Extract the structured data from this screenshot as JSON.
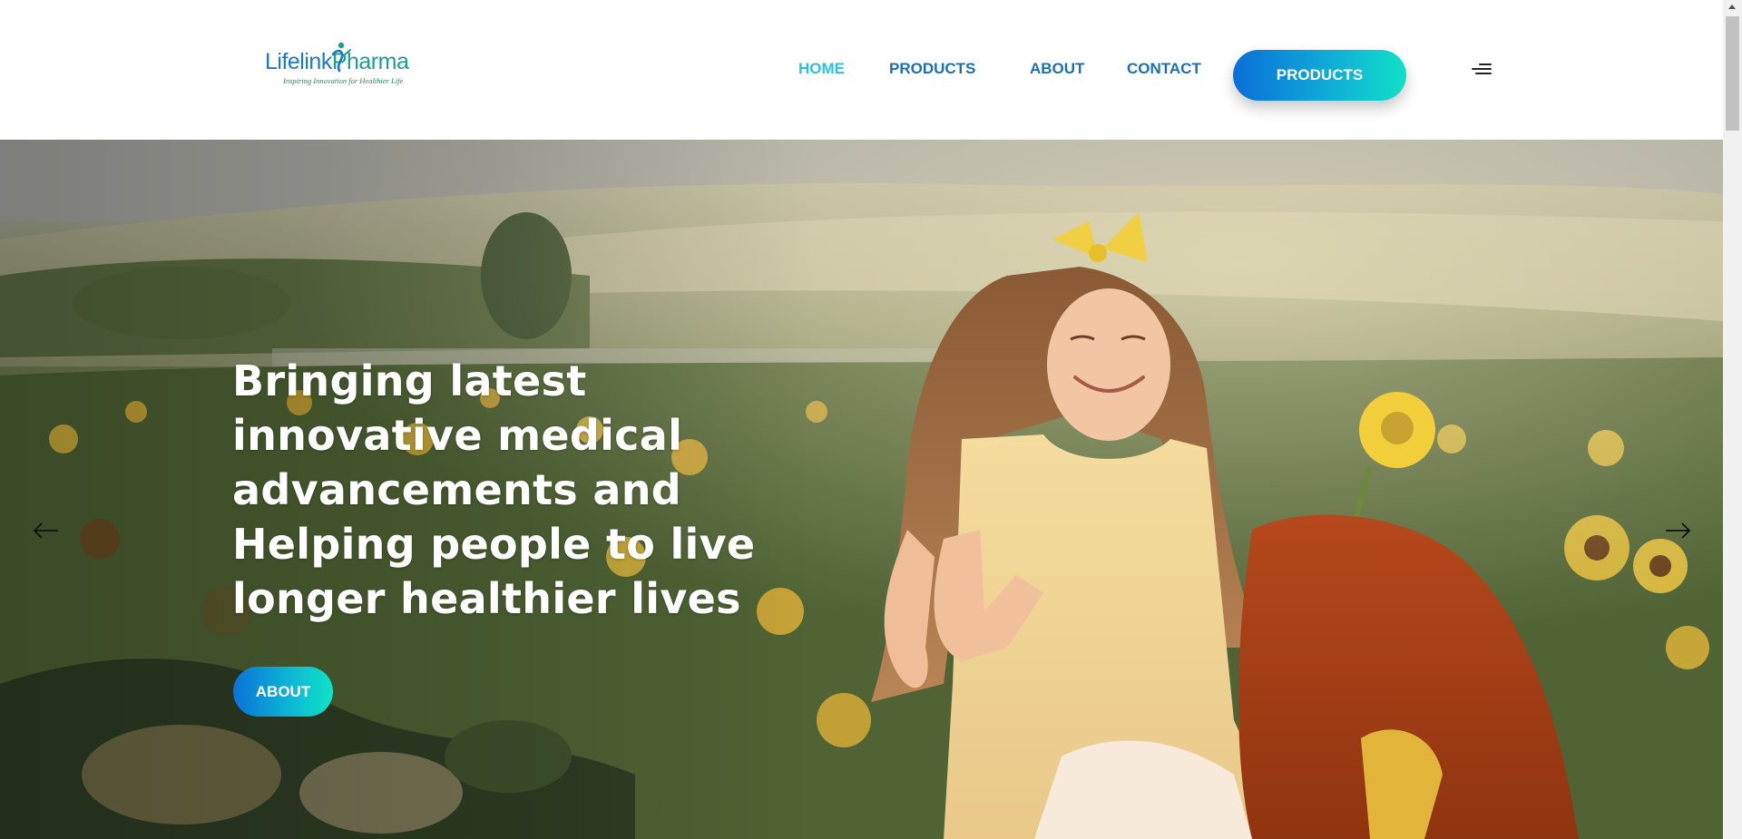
{
  "brand": {
    "name_part1": "Lifelink",
    "name_part2": "Pharma",
    "tagline": "Inspiring Innovation for Healthier Life",
    "colors": {
      "blue": "#1e78c2",
      "teal": "#1e9e8f",
      "tagline": "#2a8a55"
    }
  },
  "nav": {
    "items": [
      {
        "label": "HOME",
        "active": true
      },
      {
        "label": "PRODUCTS",
        "active": false
      },
      {
        "label": "ABOUT",
        "active": false
      },
      {
        "label": "CONTACT",
        "active": false
      }
    ],
    "cta_label": "PRODUCTS",
    "menu_icon": "hamburger-menu-icon",
    "colors": {
      "link": "#1e6fb0",
      "active": "#2dbfe6"
    }
  },
  "hero": {
    "title": "Bringing latest innovative medical advancements and Helping people to live longer healthier lives",
    "button_label": "ABOUT",
    "prev_icon": "arrow-left-icon",
    "next_icon": "arrow-right-icon",
    "accent_gradient": [
      "#0a6fd8",
      "#10e0c8"
    ]
  }
}
